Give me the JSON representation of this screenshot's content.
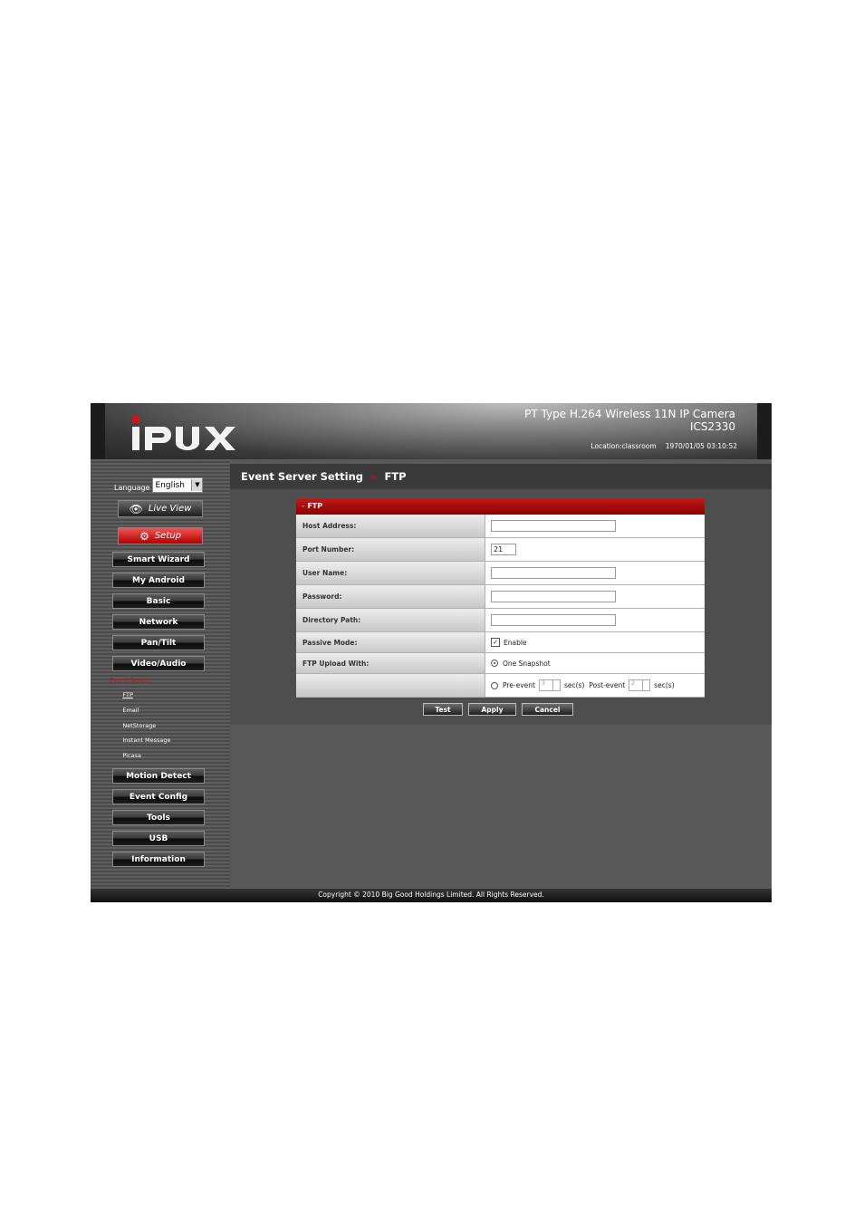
{
  "header": {
    "brand": "IPUX",
    "title_line1": "PT Type H.264 Wireless 11N IP Camera",
    "title_line2": "ICS2330",
    "location": "Location:classroom",
    "datetime": "1970/01/05 03:10:52"
  },
  "sidebar": {
    "language_label": "Language",
    "language_value": "English",
    "live_view": "Live View",
    "setup": "Setup",
    "nav": [
      "Smart Wizard",
      "My Android",
      "Basic",
      "Network",
      "Pan/Tilt",
      "Video/Audio"
    ],
    "submenu_heading": "Event Server",
    "submenu": [
      "FTP",
      "Email",
      "NetStorage",
      "Instant Message",
      "Picasa"
    ],
    "nav2": [
      "Motion Detect",
      "Event Config",
      "Tools",
      "USB",
      "Information"
    ]
  },
  "breadcrumb": {
    "section": "Event Server Setting",
    "separator": "»",
    "page": "FTP"
  },
  "panel": {
    "title": "FTP",
    "host_label": "Host Address:",
    "host_value": "",
    "port_label": "Port Number:",
    "port_value": "21",
    "user_label": "User Name:",
    "user_value": "",
    "password_label": "Password:",
    "password_value": "",
    "dir_label": "Directory Path:",
    "dir_value": "",
    "passive_label": "Passive Mode:",
    "passive_option": "Enable",
    "passive_checked": true,
    "upload_label": "FTP Upload With:",
    "upload_option1": "One Snapshot",
    "pre_event": "Pre-event",
    "pre_value": "3",
    "sec1": "sec(s)",
    "post_event": "Post-event",
    "post_value": "2",
    "sec2": "sec(s)"
  },
  "buttons": {
    "test": "Test",
    "apply": "Apply",
    "cancel": "Cancel"
  },
  "footer": "Copyright © 2010 Big Good Holdings Limited. All Rights Reserved.",
  "colors": {
    "accent": "#cc1111",
    "header_dark": "#262626",
    "panel_bg": "#595959"
  }
}
